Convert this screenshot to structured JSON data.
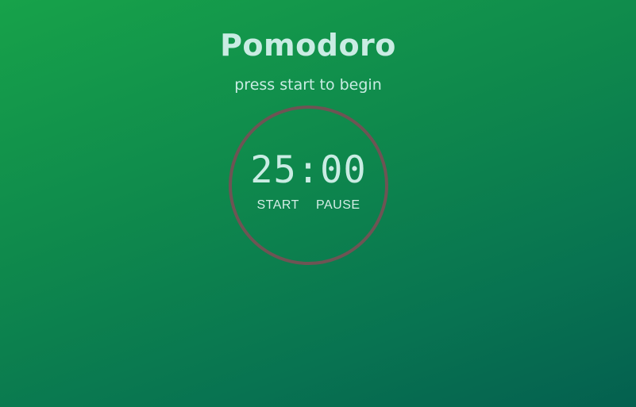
{
  "header": {
    "title": "Pomodoro",
    "subtitle": "press start to begin"
  },
  "timer": {
    "display": "25:00",
    "ring_color": "#6e5454"
  },
  "controls": {
    "start_label": "START",
    "pause_label": "PAUSE"
  },
  "colors": {
    "background_start": "#17a24a",
    "background_end": "#04604f",
    "text": "#c9ece3"
  }
}
